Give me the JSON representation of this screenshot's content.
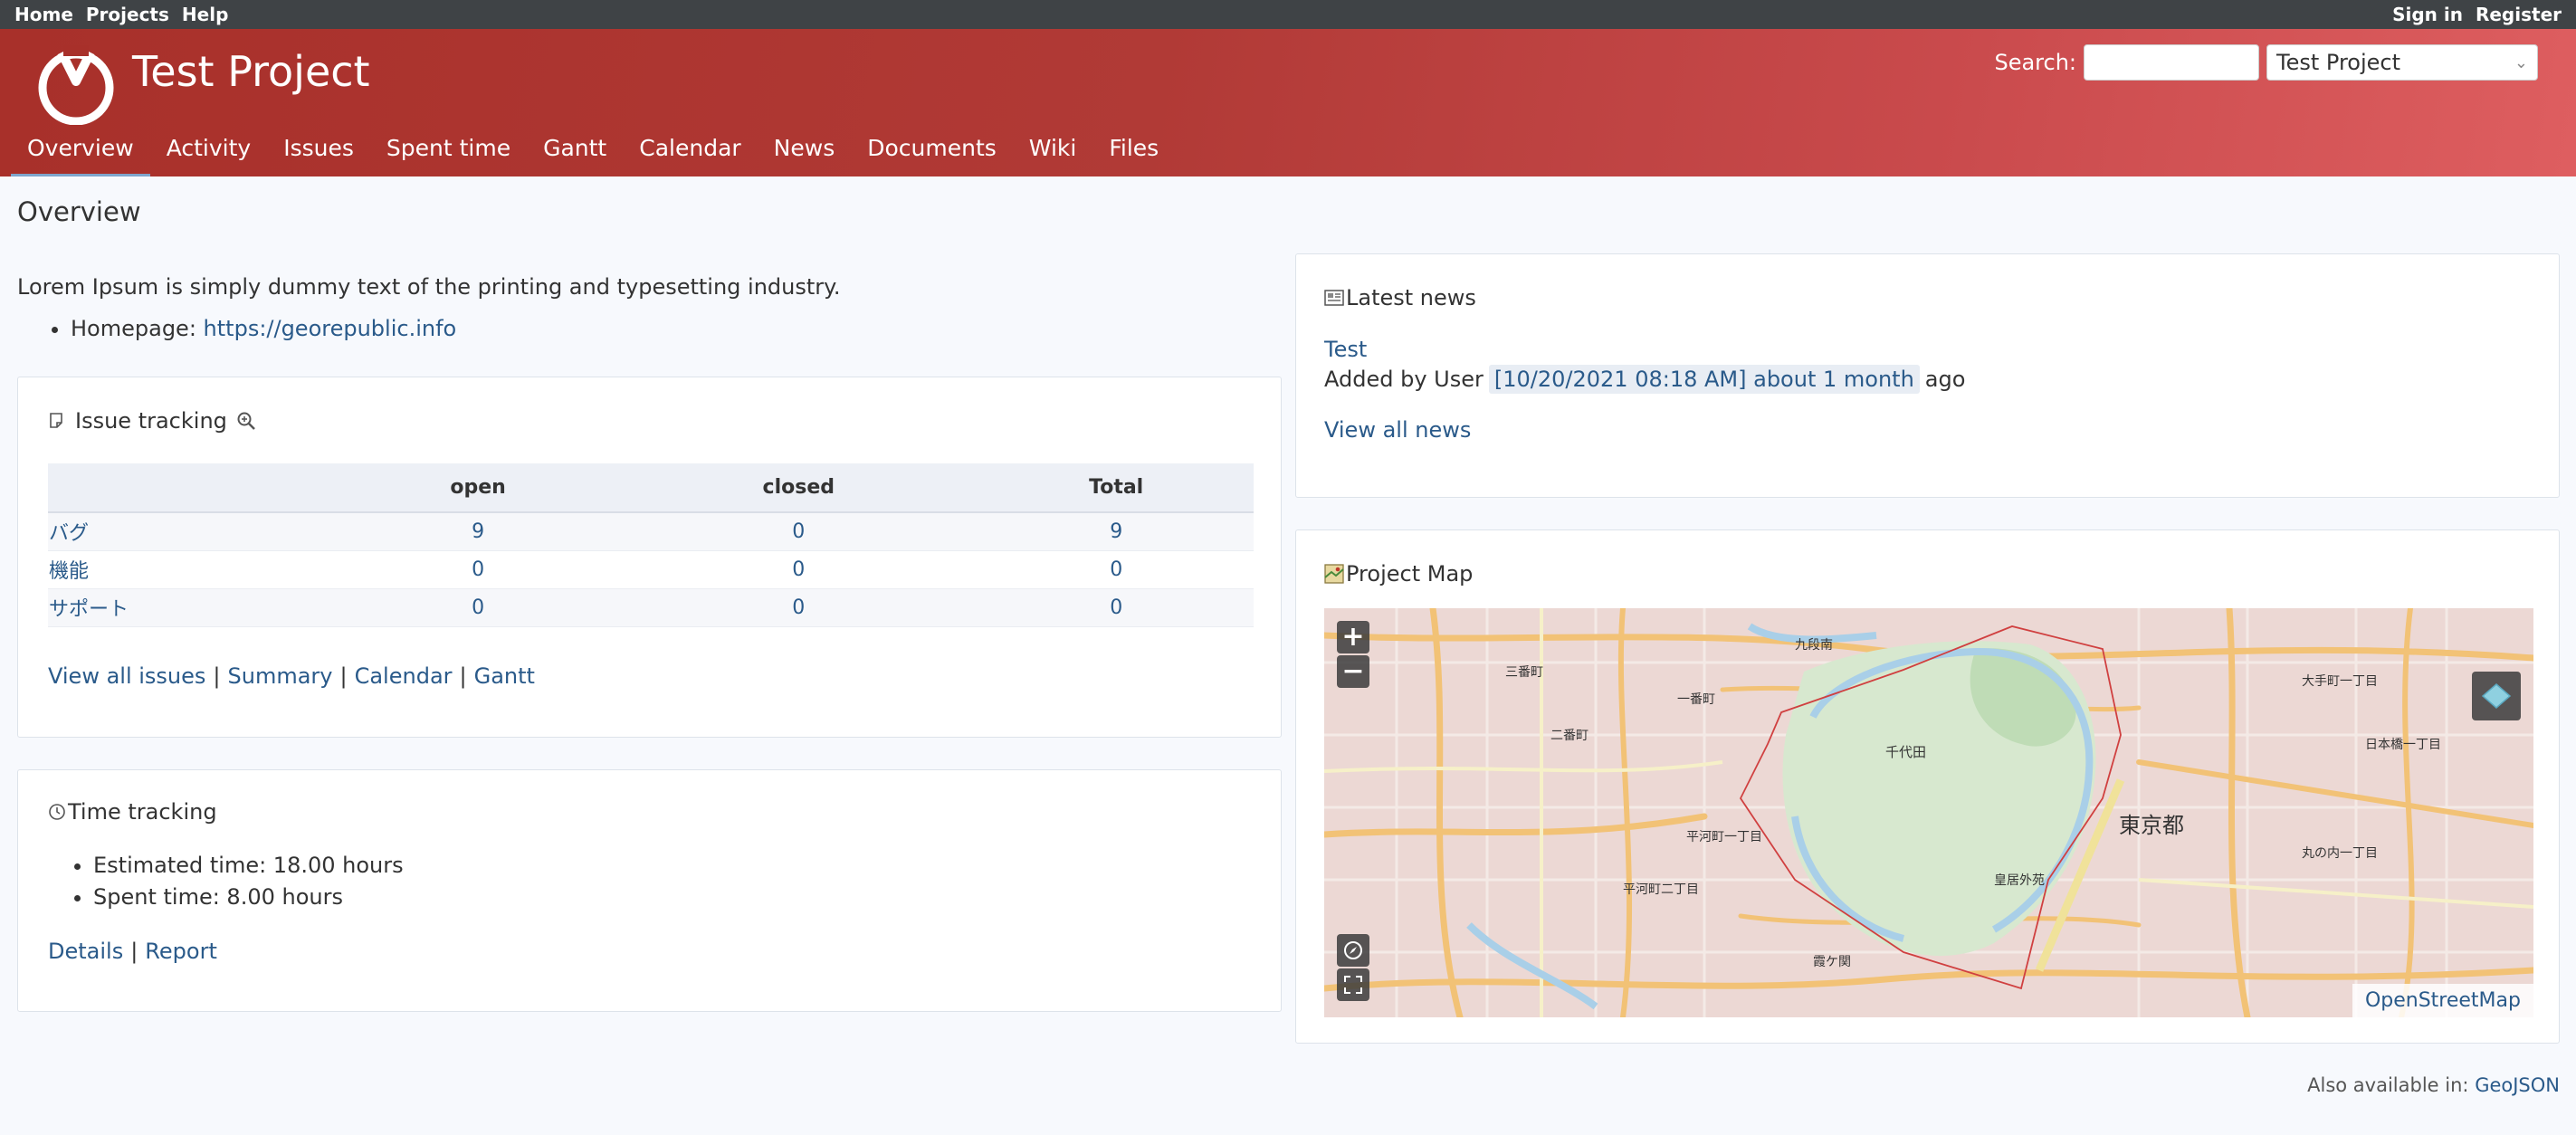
{
  "top_menu": {
    "left": [
      "Home",
      "Projects",
      "Help"
    ],
    "right": [
      "Sign in",
      "Register"
    ]
  },
  "header": {
    "project_title": "Test Project",
    "search_label": "Search:",
    "search_value": "",
    "project_jump": "Test Project"
  },
  "main_menu": [
    "Overview",
    "Activity",
    "Issues",
    "Spent time",
    "Gantt",
    "Calendar",
    "News",
    "Documents",
    "Wiki",
    "Files"
  ],
  "overview": {
    "heading": "Overview",
    "description": "Lorem Ipsum is simply dummy text of the printing and typesetting industry.",
    "homepage_label": "Homepage:",
    "homepage_url": "https://georepublic.info"
  },
  "issue_tracking": {
    "title": "Issue tracking",
    "headers": [
      "",
      "open",
      "closed",
      "Total"
    ],
    "rows": [
      {
        "name": "バグ",
        "open": "9",
        "closed": "0",
        "total": "9"
      },
      {
        "name": "機能",
        "open": "0",
        "closed": "0",
        "total": "0"
      },
      {
        "name": "サポート",
        "open": "0",
        "closed": "0",
        "total": "0"
      }
    ],
    "links": [
      "View all issues",
      "Summary",
      "Calendar",
      "Gantt"
    ]
  },
  "time_tracking": {
    "title": "Time tracking",
    "items": [
      "Estimated time: 18.00 hours",
      "Spent time: 8.00 hours"
    ],
    "links": [
      "Details",
      "Report"
    ]
  },
  "news": {
    "title": "Latest news",
    "item_title": "Test",
    "added_by": "Added by User",
    "stamp": "[10/20/2021 08:18 AM] about 1 month",
    "ago": "ago",
    "view_all": "View all news"
  },
  "map": {
    "title": "Project Map",
    "zoom_in": "+",
    "zoom_out": "−",
    "attribution": "OpenStreetMap",
    "labels": [
      "東京都",
      "千代田",
      "一番町",
      "二番町",
      "三番町",
      "平河町一丁目",
      "平河町二丁目",
      "霞ケ関",
      "大手町一丁目",
      "丸の内一丁目",
      "日本橋一丁目",
      "皇居外苑",
      "九段南"
    ]
  },
  "footer": {
    "also_available": "Also available in:",
    "format": "GeoJSON"
  },
  "colors": {
    "header_start": "#a8302a",
    "header_end": "#de5e60",
    "link": "#2a5a8a",
    "top_menu": "#3f4346"
  }
}
